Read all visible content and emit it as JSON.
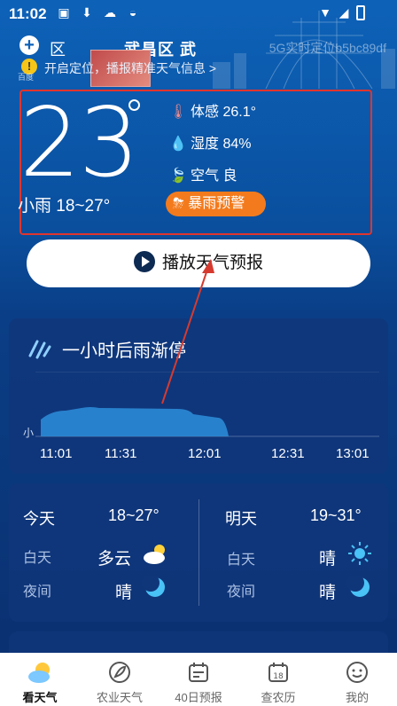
{
  "status_bar": {
    "time": "11:02"
  },
  "header": {
    "location_short": "区",
    "location_main": "武昌区 武",
    "watermark": "5G实时定位b5bc89df",
    "notice_small": "百度",
    "notice_text": "开启定位，播报精准天气信息 >"
  },
  "current": {
    "temperature": "23",
    "condition": "小雨  18~27°",
    "feels_like": "体感 26.1°",
    "humidity": "湿度 84%",
    "air_quality": "空气 良",
    "alert": "暴雨预警"
  },
  "play_button": {
    "label": "播放天气预报"
  },
  "rain_card": {
    "title": "一小时后雨渐停",
    "intensity_label": "小",
    "times": [
      "11:01",
      "11:31",
      "12:01",
      "12:31",
      "13:01"
    ]
  },
  "forecast": {
    "today": {
      "label": "今天",
      "range": "18~27°",
      "day_label": "白天",
      "day_cond": "多云",
      "night_label": "夜间",
      "night_cond": "晴"
    },
    "tomorrow": {
      "label": "明天",
      "range": "19~31°",
      "day_label": "白天",
      "day_cond": "晴",
      "night_label": "夜间",
      "night_cond": "晴"
    }
  },
  "bottom_nav": [
    {
      "label": "看天气",
      "icon": "weather-icon",
      "active": true
    },
    {
      "label": "农业天气",
      "icon": "agriculture-icon",
      "active": false
    },
    {
      "label": "40日预报",
      "icon": "calendar-icon",
      "active": false
    },
    {
      "label": "查农历",
      "icon": "lunar-calendar-icon",
      "active": false
    },
    {
      "label": "我的",
      "icon": "profile-icon",
      "active": false
    }
  ],
  "colors": {
    "accent_alert": "#f37b1d",
    "highlight_box": "#e0352d",
    "annotation_arrow": "#d63a2f"
  }
}
